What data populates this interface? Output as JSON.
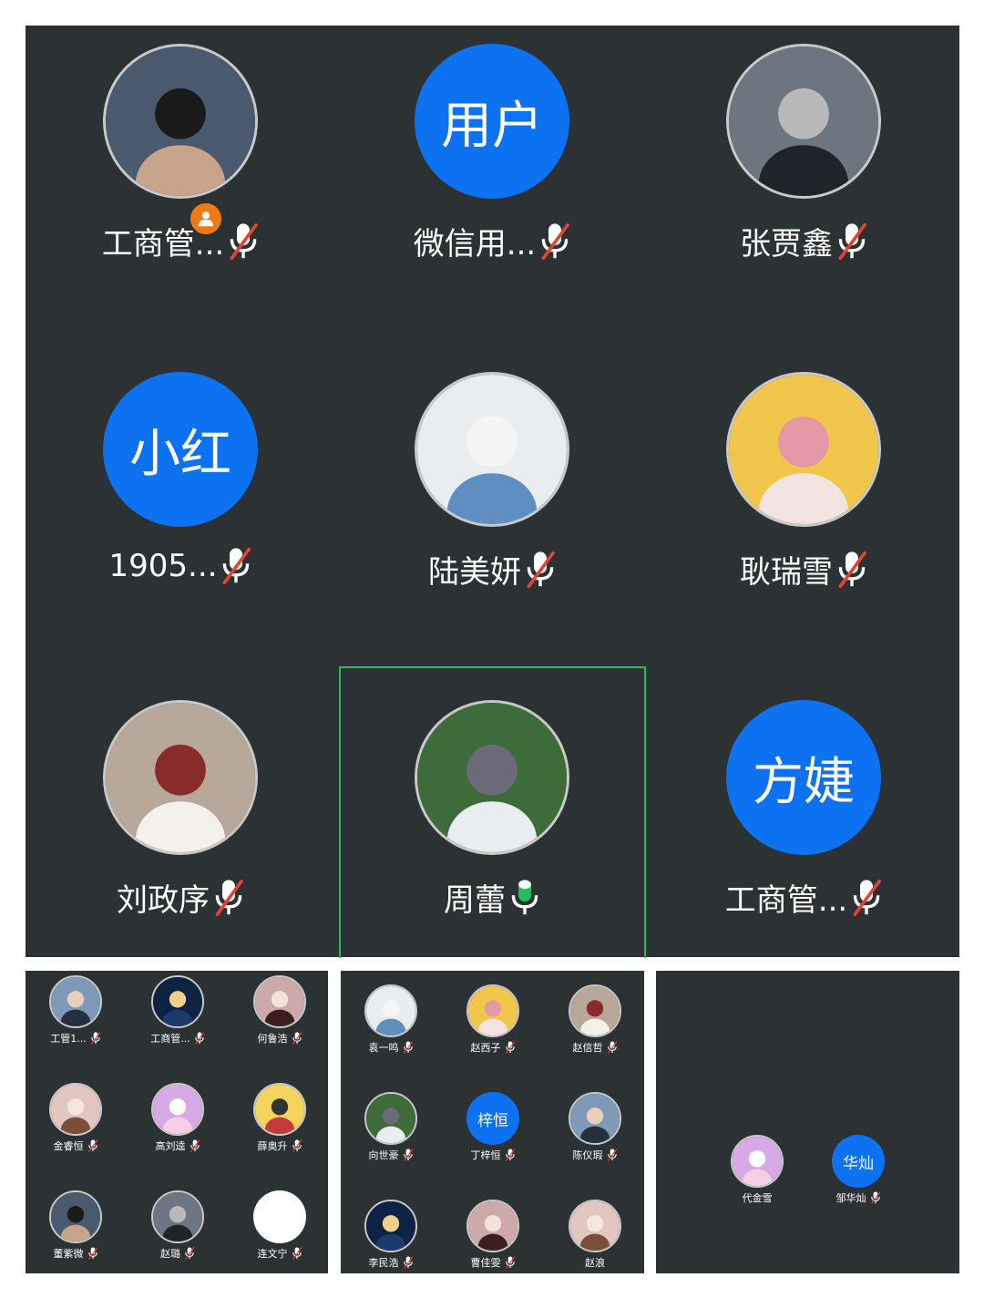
{
  "main": {
    "participants": [
      {
        "name": "工商管...",
        "avatar": "photo",
        "avatar_text": "",
        "mic": "muted",
        "host_badge": true
      },
      {
        "name": "微信用...",
        "avatar": "text",
        "avatar_text": "用户",
        "mic": "muted",
        "host_badge": false
      },
      {
        "name": "张贾鑫",
        "avatar": "photo",
        "avatar_text": "",
        "mic": "muted",
        "host_badge": false
      },
      {
        "name": "1905...",
        "avatar": "text",
        "avatar_text": "小红",
        "mic": "muted",
        "host_badge": false
      },
      {
        "name": "陆美妍",
        "avatar": "photo",
        "avatar_text": "",
        "mic": "muted",
        "host_badge": false
      },
      {
        "name": "耿瑞雪",
        "avatar": "photo",
        "avatar_text": "",
        "mic": "muted",
        "host_badge": false
      },
      {
        "name": "刘政序",
        "avatar": "photo",
        "avatar_text": "",
        "mic": "muted",
        "host_badge": false
      },
      {
        "name": "周蕾",
        "avatar": "photo",
        "avatar_text": "",
        "mic": "speaking",
        "host_badge": false
      },
      {
        "name": "工商管...",
        "avatar": "text",
        "avatar_text": "方婕",
        "mic": "muted",
        "host_badge": false
      }
    ]
  },
  "page1": {
    "participants": [
      {
        "name": "工管1...",
        "avatar": "photo",
        "avatar_text": "",
        "mic": "muted"
      },
      {
        "name": "工商管...",
        "avatar": "photo",
        "avatar_text": "",
        "mic": "muted"
      },
      {
        "name": "何鲁浩",
        "avatar": "photo",
        "avatar_text": "",
        "mic": "muted"
      },
      {
        "name": "金睿恒",
        "avatar": "photo",
        "avatar_text": "",
        "mic": "muted"
      },
      {
        "name": "高刘逵",
        "avatar": "photo",
        "avatar_text": "",
        "mic": "muted"
      },
      {
        "name": "薛奥升",
        "avatar": "photo",
        "avatar_text": "",
        "mic": "muted"
      },
      {
        "name": "董紫微",
        "avatar": "photo",
        "avatar_text": "",
        "mic": "muted"
      },
      {
        "name": "赵璐",
        "avatar": "photo",
        "avatar_text": "",
        "mic": "muted"
      },
      {
        "name": "连文宁",
        "avatar": "blank",
        "avatar_text": "",
        "mic": "muted"
      }
    ]
  },
  "page2": {
    "participants": [
      {
        "name": "袁一鸣",
        "avatar": "photo",
        "avatar_text": "",
        "mic": "muted"
      },
      {
        "name": "赵西子",
        "avatar": "photo",
        "avatar_text": "",
        "mic": "muted"
      },
      {
        "name": "赵信哲",
        "avatar": "photo",
        "avatar_text": "",
        "mic": "muted"
      },
      {
        "name": "向世豪",
        "avatar": "photo",
        "avatar_text": "",
        "mic": "muted"
      },
      {
        "name": "丁梓恒",
        "avatar": "text",
        "avatar_text": "梓恒",
        "mic": "muted"
      },
      {
        "name": "陈仪瑕",
        "avatar": "photo",
        "avatar_text": "",
        "mic": "muted"
      },
      {
        "name": "李民浩",
        "avatar": "photo",
        "avatar_text": "",
        "mic": "muted"
      },
      {
        "name": "曹佳雯",
        "avatar": "photo",
        "avatar_text": "",
        "mic": "muted"
      },
      {
        "name": "赵浪",
        "avatar": "photo",
        "avatar_text": "",
        "mic": "none"
      }
    ]
  },
  "page3": {
    "participants": [
      {
        "name": "代金雪",
        "avatar": "photo",
        "avatar_text": "",
        "mic": "none"
      },
      {
        "name": "邹华灿",
        "avatar": "text",
        "avatar_text": "华灿",
        "mic": "muted"
      }
    ]
  },
  "colors": {
    "panel_bg": "#2c3133",
    "text_avatar_bg": "#0d72f2",
    "speaking_green": "#1fbf5a",
    "muted_red": "#e8412f",
    "host_badge": "#f07b12"
  }
}
